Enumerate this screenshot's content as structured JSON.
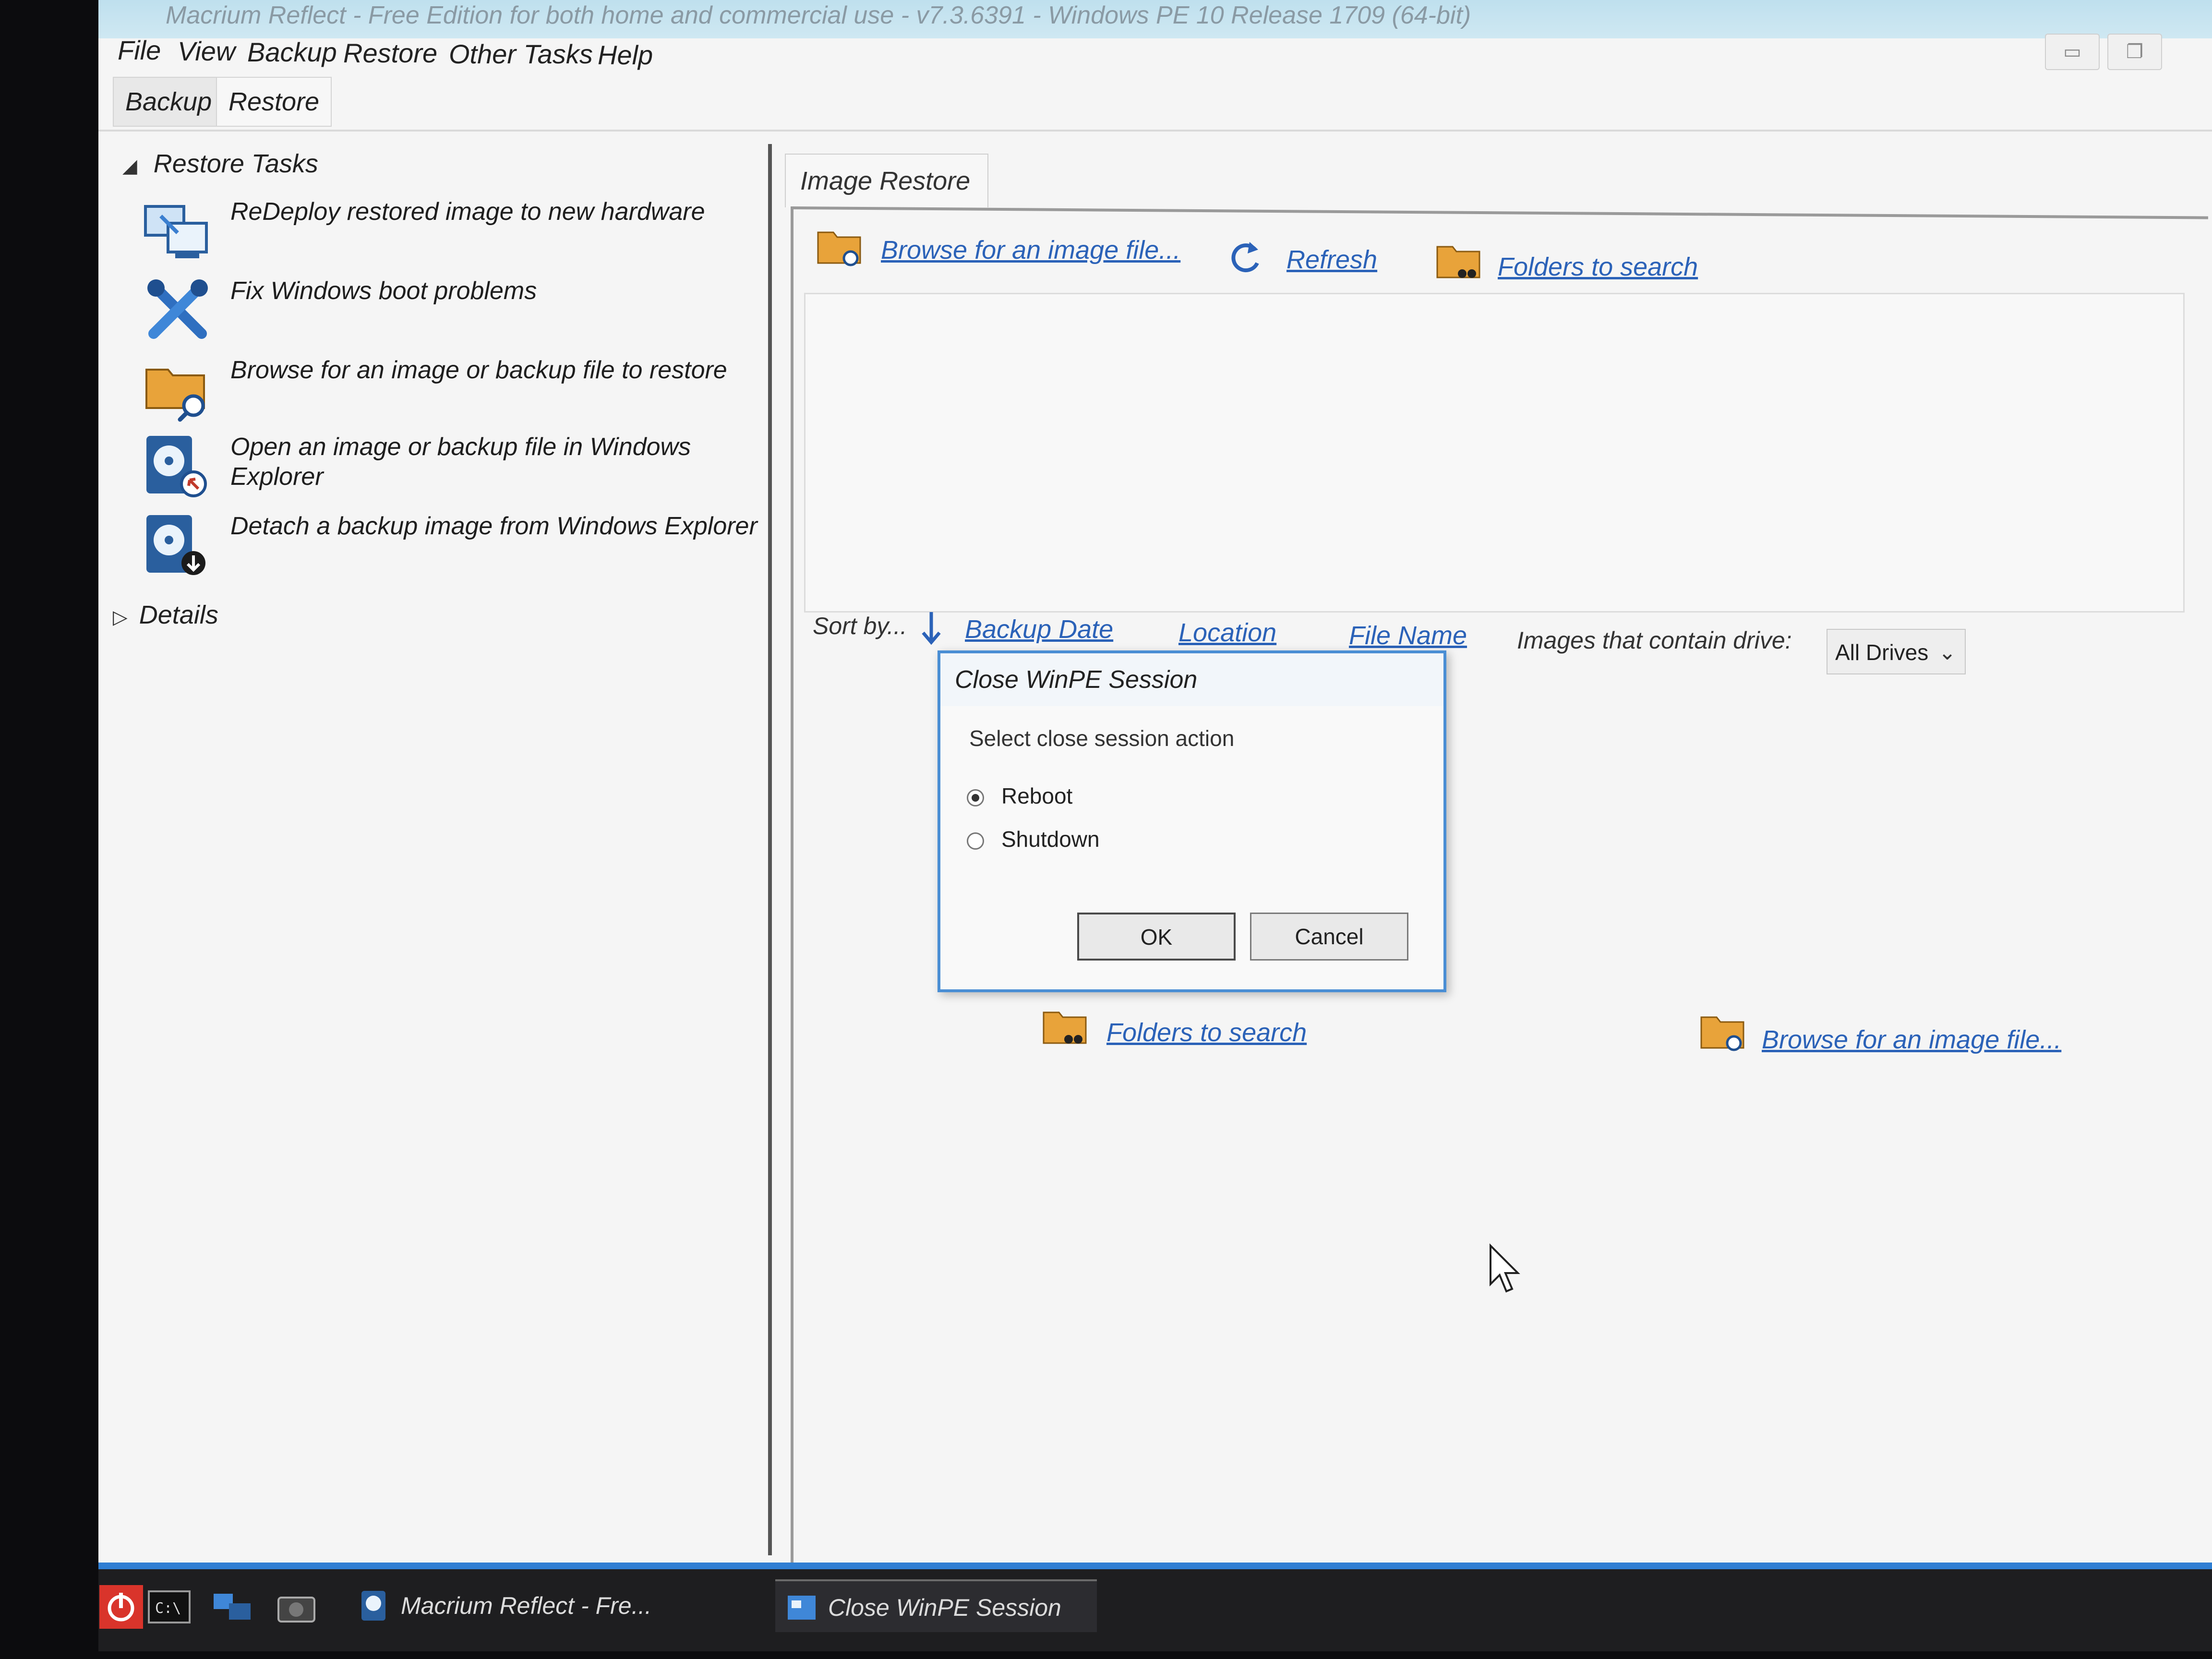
{
  "window": {
    "title": "Macrium Reflect - Free Edition for both home and commercial use - v7.3.6391 - Windows PE 10 Release 1709 (64-bit)"
  },
  "menu": [
    "File",
    "View",
    "Backup",
    "Restore",
    "Other Tasks",
    "Help"
  ],
  "toolbar_tabs": [
    {
      "label": "Backup",
      "active": false
    },
    {
      "label": "Restore",
      "active": true
    }
  ],
  "sidebar": {
    "restore_tasks_heading": "Restore Tasks",
    "tasks": [
      {
        "label": "ReDeploy restored image to new hardware",
        "icon": "redeploy-icon"
      },
      {
        "label": "Fix Windows boot problems",
        "icon": "tools-icon"
      },
      {
        "label": "Browse for an image or backup file to restore",
        "icon": "folder-search-icon"
      },
      {
        "label": "Open an image or backup file in Windows Explorer",
        "icon": "disk-open-icon"
      },
      {
        "label": "Detach a backup image from Windows Explorer",
        "icon": "disk-detach-icon"
      }
    ],
    "details_heading": "Details"
  },
  "main": {
    "tab_label": "Image Restore",
    "top_links": {
      "browse": "Browse for an image file...",
      "refresh": "Refresh",
      "folders": "Folders to search"
    },
    "sort": {
      "label": "Sort by...",
      "options": [
        "Backup Date",
        "Location",
        "File Name"
      ],
      "active": "Backup Date"
    },
    "drive_filter_label": "Images that contain drive:",
    "drive_filter_value": "All Drives",
    "bottom_links": {
      "folders": "Folders to search",
      "browse": "Browse for an image file..."
    }
  },
  "dialog": {
    "title": "Close WinPE Session",
    "prompt": "Select close session action",
    "options": [
      {
        "label": "Reboot",
        "selected": true
      },
      {
        "label": "Shutdown",
        "selected": false
      }
    ],
    "ok_label": "OK",
    "cancel_label": "Cancel"
  },
  "taskbar": {
    "items": [
      {
        "label": "Macrium Reflect - Fre...",
        "active": false
      },
      {
        "label": "Close WinPE Session",
        "active": true
      }
    ]
  },
  "colors": {
    "link": "#2b62b8",
    "accent": "#2f7fd3",
    "dialog_border": "#4a8ed4",
    "folder": "#e8a33a"
  }
}
